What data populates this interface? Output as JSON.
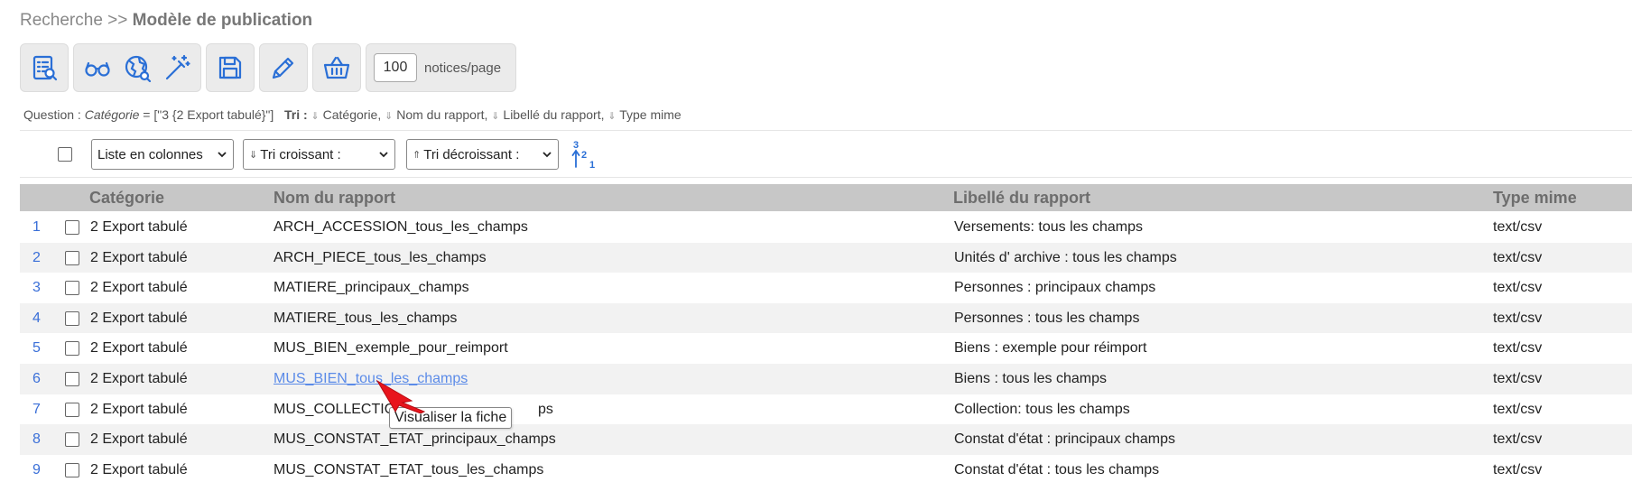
{
  "breadcrumb": {
    "parent": "Recherche >>",
    "current": "Modèle de publication"
  },
  "toolbar": {
    "groups": [
      [
        {
          "icon": "report-list-icon"
        }
      ],
      [
        {
          "icon": "glasses-icon"
        },
        {
          "icon": "globe-icon"
        },
        {
          "icon": "magic-wand-icon"
        }
      ],
      [
        {
          "icon": "save-icon"
        }
      ],
      [
        {
          "icon": "pencil-icon"
        }
      ],
      [
        {
          "icon": "basket-icon"
        }
      ]
    ],
    "notices_per_page_value": "100",
    "notices_per_page_label": "notices/page",
    "accent_color": "#2a6fd6"
  },
  "question": {
    "label": "Question :",
    "field": "Catégorie",
    "expr": " = [\"3 {2 Export tabulé}\"]",
    "sort_label": "Tri :",
    "sort_items": [
      "Catégorie,",
      "Nom du rapport,",
      "Libellé du rapport,",
      "Type mime"
    ]
  },
  "controls": {
    "display_mode": "Liste en colonnes",
    "sort_asc": "Tri croissant :",
    "sort_desc": "Tri décroissant :",
    "sort_asc_arrow": "⇓",
    "sort_desc_arrow": "⇑"
  },
  "table": {
    "headers": [
      "Catégorie",
      "Nom du rapport",
      "Libellé du rapport",
      "Type mime"
    ],
    "rows": [
      {
        "num": "1",
        "category": "2 Export tabulé",
        "name": "ARCH_ACCESSION_tous_les_champs",
        "label": "Versements: tous les champs",
        "mime": "text/csv"
      },
      {
        "num": "2",
        "category": "2 Export tabulé",
        "name": "ARCH_PIECE_tous_les_champs",
        "label": "Unités d' archive : tous les champs",
        "mime": "text/csv"
      },
      {
        "num": "3",
        "category": "2 Export tabulé",
        "name": "MATIERE_principaux_champs",
        "label": "Personnes : principaux champs",
        "mime": "text/csv"
      },
      {
        "num": "4",
        "category": "2 Export tabulé",
        "name": "MATIERE_tous_les_champs",
        "label": "Personnes : tous les champs",
        "mime": "text/csv"
      },
      {
        "num": "5",
        "category": "2 Export tabulé",
        "name": "MUS_BIEN_exemple_pour_reimport",
        "label": "Biens : exemple pour réimport",
        "mime": "text/csv"
      },
      {
        "num": "6",
        "category": "2 Export tabulé",
        "name": "MUS_BIEN_tous_les_champs",
        "label": "Biens : tous les champs",
        "mime": "text/csv"
      },
      {
        "num": "7",
        "category": "2 Export tabulé",
        "name": "MUS_COLLECTIO",
        "name_tail": "ps",
        "label": "Collection: tous les champs",
        "mime": "text/csv"
      },
      {
        "num": "8",
        "category": "2 Export tabulé",
        "name": "MUS_CONSTAT_ETAT_principaux_champs",
        "label": "Constat d'état : principaux champs",
        "mime": "text/csv"
      },
      {
        "num": "9",
        "category": "2 Export tabulé",
        "name": "MUS_CONSTAT_ETAT_tous_les_champs",
        "label": "Constat d'état : tous les champs",
        "mime": "text/csv"
      }
    ]
  },
  "tooltip": {
    "text": "Visualiser la fiche"
  }
}
